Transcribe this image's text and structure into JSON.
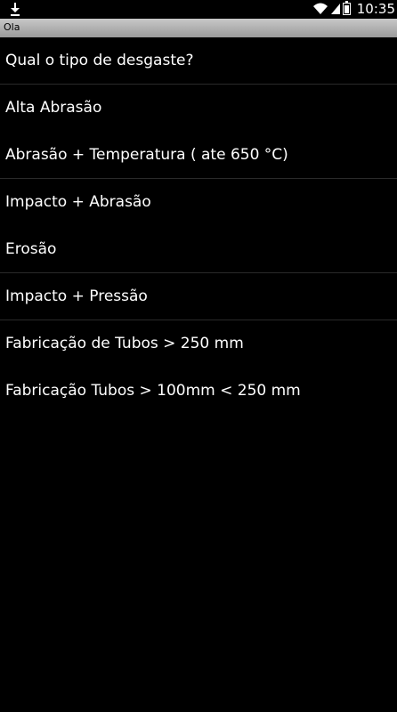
{
  "status_bar": {
    "time": "10:35",
    "icons": [
      "download-icon",
      "wifi-icon",
      "signal-icon",
      "battery-icon"
    ]
  },
  "title_bar": {
    "title": "Ola"
  },
  "list": {
    "items": [
      {
        "label": "Qual o tipo de desgaste?"
      },
      {
        "label": "Alta Abrasão"
      },
      {
        "label": "Abrasão + Temperatura ( ate 650 °C)"
      },
      {
        "label": "Impacto + Abrasão"
      },
      {
        "label": "Erosão"
      },
      {
        "label": "Impacto + Pressão"
      },
      {
        "label": "Fabricação de Tubos > 250 mm"
      },
      {
        "label": "Fabricação Tubos > 100mm < 250 mm"
      }
    ]
  }
}
